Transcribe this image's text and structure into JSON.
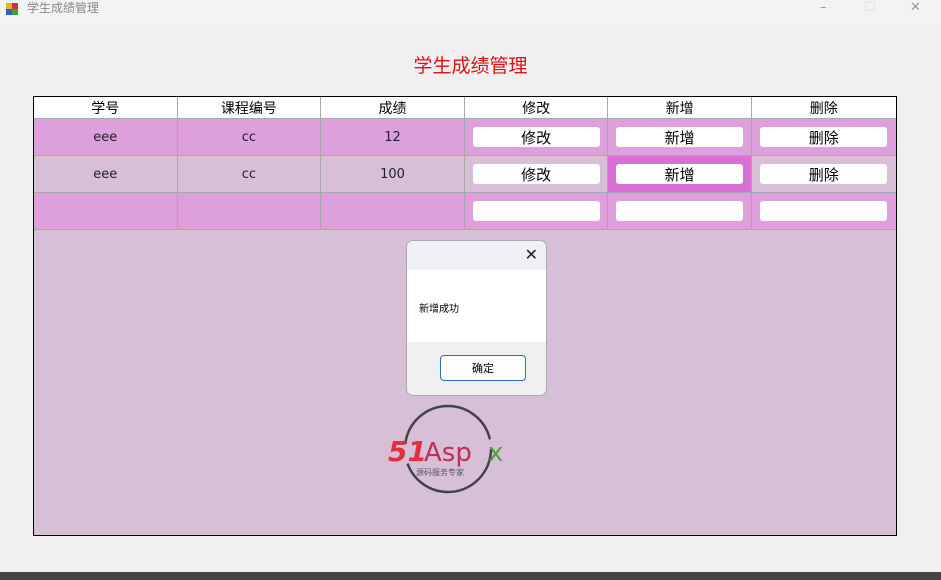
{
  "window": {
    "title": "学生成绩管理",
    "minimize": "–",
    "maximize": "☐",
    "close": "✕"
  },
  "heading": "学生成绩管理",
  "table": {
    "headers": [
      "学号",
      "课程编号",
      "成绩",
      "修改",
      "新增",
      "删除"
    ],
    "rows": [
      {
        "id": "eee",
        "course": "cc",
        "score": "12",
        "edit": "修改",
        "add": "新增",
        "del": "删除"
      },
      {
        "id": "eee",
        "course": "cc",
        "score": "100",
        "edit": "修改",
        "add": "新增",
        "del": "删除"
      },
      {
        "id": "",
        "course": "",
        "score": "",
        "edit": "",
        "add": "",
        "del": ""
      }
    ]
  },
  "dialog": {
    "message": "新增成功",
    "ok": "确定",
    "close": "✕"
  },
  "logo": {
    "brand": "51Aspx",
    "tagline": "源码服务专家"
  },
  "colors": {
    "row_odd": "#dda0dd",
    "row_even": "#d8bfd8",
    "selected": "#da70d6",
    "heading": "#e01010"
  }
}
